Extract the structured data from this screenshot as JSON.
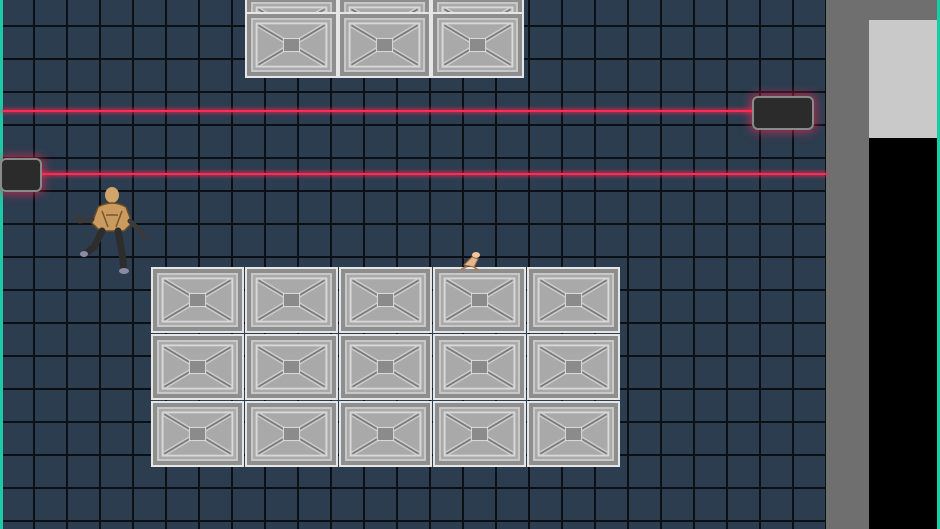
{
  "scene": {
    "floor": {
      "color": "#2c3d50",
      "grid_line_color": "#0c0f13"
    },
    "frame_color": "#1ec9a6",
    "wall_color": "#6f6f6f",
    "laser_color": "#ff2a55"
  },
  "icons": {
    "player": "humanoid-character-icon",
    "small_figure": "small-creature-icon",
    "crate": "metal-crate-icon",
    "laser_emitter": "laser-emitter-icon"
  }
}
